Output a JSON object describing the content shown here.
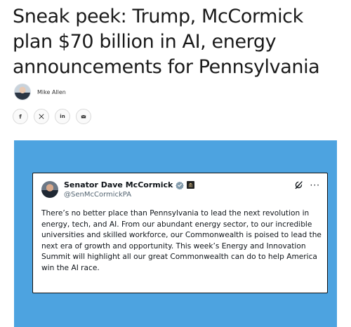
{
  "article": {
    "headline": "Sneak peek: Trump, McCormick plan $70 billion in AI, energy announcements for Pennsylvania",
    "author": "Mike Allen"
  },
  "share": {
    "facebook": "f",
    "linkedin": "in",
    "icons": [
      "facebook-icon",
      "x-icon",
      "linkedin-icon",
      "email-icon"
    ]
  },
  "embed": {
    "background_color": "#4da3e0",
    "tweet": {
      "name": "Senator Dave McCormick",
      "handle": "@SenMcCormickPA",
      "text": "There’s no better place than Pennsylvania to lead the next revolution in energy, tech, and AI. From our abundant energy sector, to our incredible universities and skilled workforce, our Commonwealth is poised to lead the next era of growth and opportunity. This week’s Energy and Innovation Summit will highlight all our great Commonwealth can do to help America win the AI race.",
      "more": "···",
      "verified_color": "#829aab"
    }
  }
}
